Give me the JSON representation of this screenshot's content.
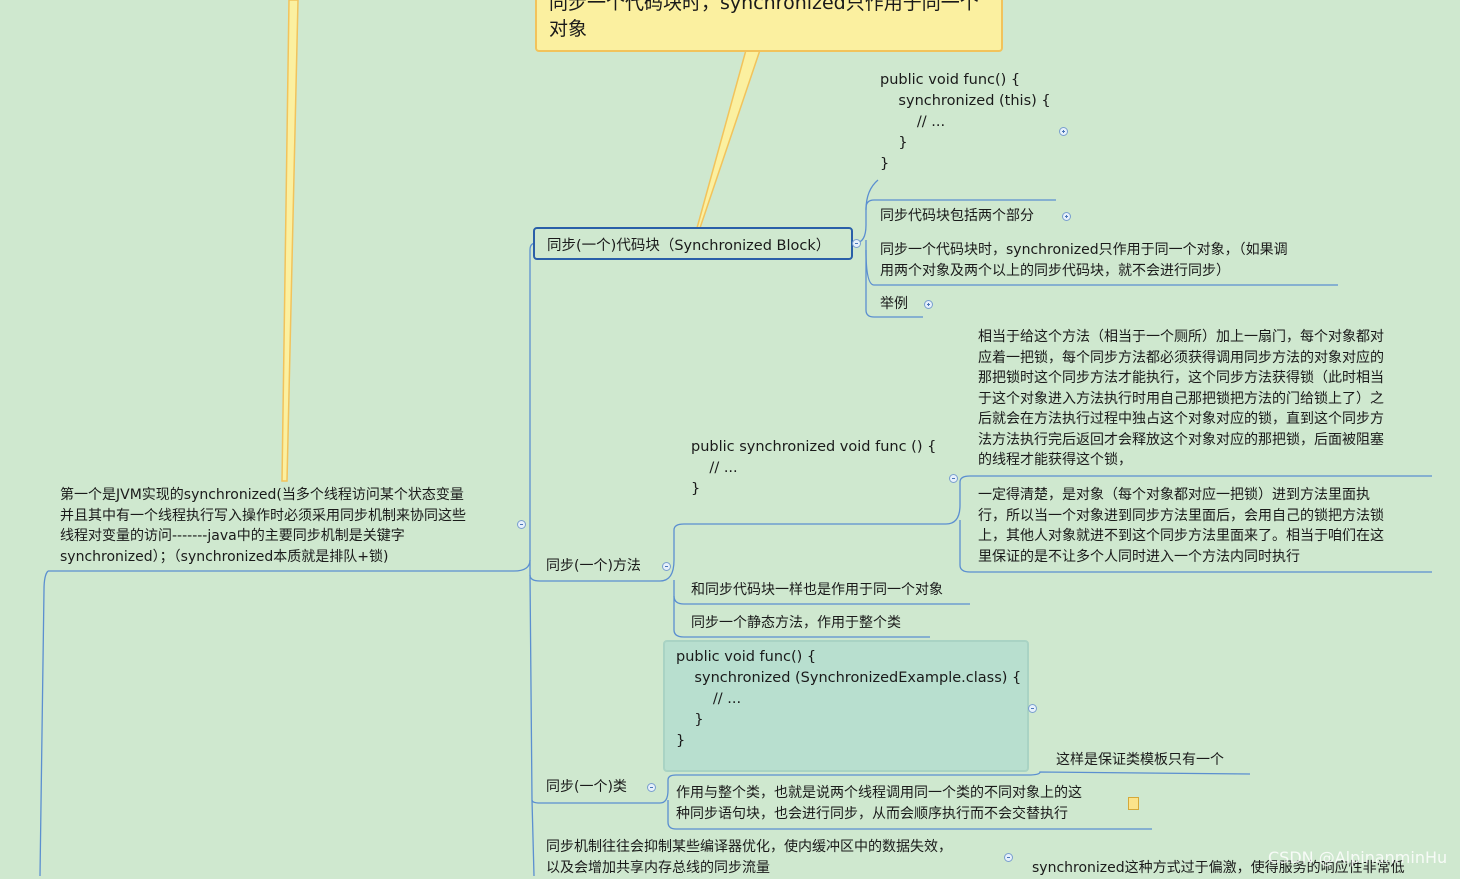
{
  "callout": {
    "line1": "同步一个代码块时，synchronized只作用于同一个",
    "line2": "对象"
  },
  "root": {
    "lines": [
      "第一个是JVM实现的synchronized(当多个线程访问某个状态变量",
      "并且其中有一个线程执行写入操作时必须采用同步机制来协同这些",
      "线程对变量的访问-------java中的主要同步机制是关键字",
      "synchronized）；（synchronized本质就是排队+锁)"
    ]
  },
  "block": {
    "label": "同步(一个)代码块（Synchronized Block）",
    "code": "public void func() {\n    synchronized (this) {\n        // ...\n    }\n}",
    "two_parts": "同步代码块包括两个部分",
    "only_same_lines": [
      "同步一个代码块时，synchronized只作用于同一个对象，（如果调",
      "用两个对象及两个以上的同步代码块，就不会进行同步）"
    ],
    "example": "举例"
  },
  "method": {
    "label": "同步(一个)方法",
    "code": "public synchronized void func () {\n    // ...\n}",
    "lock_desc_lines": [
      "相当于给这个方法（相当于一个厕所）加上一扇门，每个对象都对",
      "应着一把锁，每个同步方法都必须获得调用同步方法的对象对应的",
      "那把锁时这个同步方法才能执行，这个同步方法获得锁（此时相当",
      "于这个对象进入方法执行时用自己那把锁把方法的门给锁上了）之",
      "后就会在方法执行过程中独占这个对象对应的锁，直到这个同步方",
      "法方法执行完后返回才会释放这个对象对应的那把锁，后面被阻塞",
      "的线程才能获得这个锁，"
    ],
    "object_lines": [
      "一定得清楚，是对象（每个对象都对应一把锁）进到方法里面执",
      "行，所以当一个对象进到同步方法里面后，会用自己的锁把方法锁",
      "上，其他人对象就进不到这个同步方法里面来了。相当于咱们在这",
      "里保证的是不让多个人同时进入一个方法内同时执行"
    ],
    "same_as_block": "和同步代码块一样也是作用于同一个对象",
    "static_method": "同步一个静态方法，作用于整个类"
  },
  "class_node": {
    "label": "同步(一个)类",
    "code": "public void func() {\n    synchronized (SynchronizedExample.class) {\n        // ...\n    }\n}",
    "template_once": "这样是保证类模板只有一个",
    "whole_class_lines": [
      "作用与整个类，也就是说两个线程调用同一个类的不同对象上的这",
      "种同步语句块，也会进行同步，从而会顺序执行而不会交替执行"
    ]
  },
  "optimization": {
    "lines": [
      "同步机制往往会抑制某些编译器优化，使内缓冲区中的数据失效，",
      "以及会增加共享内存总线的同步流量"
    ],
    "right_text": "synchronized这种方式过于偏激，使得服务的响应性非常低"
  },
  "watermark": "CSDN @AlpinanminHu"
}
